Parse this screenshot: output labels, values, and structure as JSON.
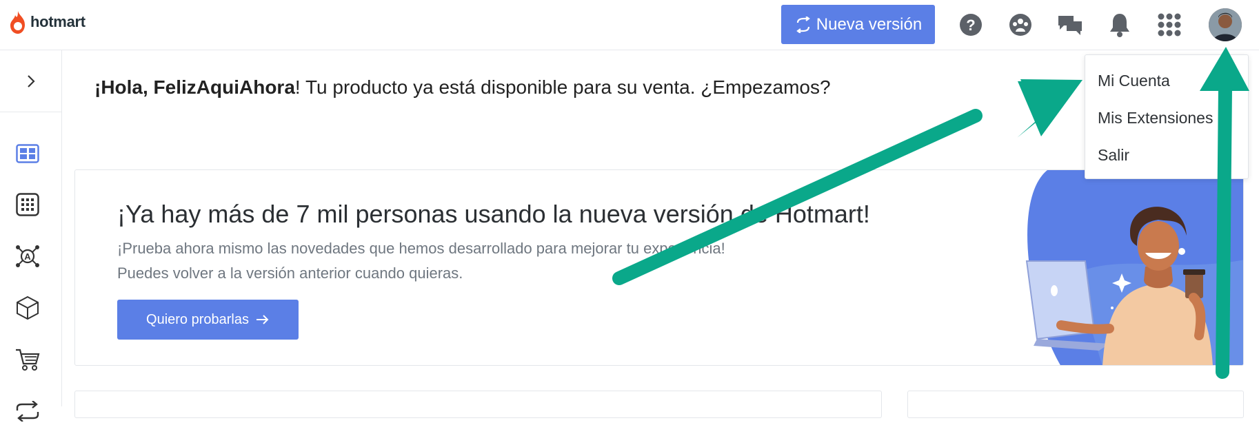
{
  "brand": {
    "name": "hotmart",
    "accent": "#f04e23"
  },
  "header": {
    "new_version_label": "Nueva versión",
    "icons": [
      "help-icon",
      "community-icon",
      "chat-icon",
      "notifications-icon",
      "apps-grid-icon"
    ],
    "accent": "#5b7fe6"
  },
  "sidebar": {
    "items": [
      "dashboard-icon",
      "apps-icon",
      "affiliate-network-icon",
      "product-box-icon",
      "cart-icon",
      "recurrence-icon"
    ]
  },
  "greeting": {
    "name": "¡Hola, FelizAquiAhora",
    "message": "! Tu producto ya está disponible para su venta. ¿Empezamos?"
  },
  "banner": {
    "title": "¡Ya hay más de 7 mil personas usando la nueva versión de Hotmart!",
    "subtitle": "¡Prueba ahora mismo las novedades que hemos desarrollado para mejorar tu experiencia!",
    "subtitle2": "Puedes volver a la versión anterior cuando quieras.",
    "cta_label": "Quiero probarlas"
  },
  "account_menu": {
    "items": [
      "Mi Cuenta",
      "Mis Extensiones",
      "Salir"
    ]
  },
  "annotation": {
    "arrow_color": "#0aa88a"
  }
}
